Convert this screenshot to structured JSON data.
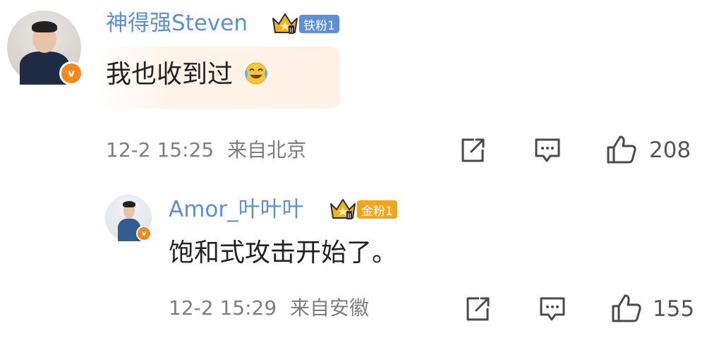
{
  "comments": [
    {
      "username": "神得强Steven",
      "fan_badge": "铁粉1",
      "text": "我也收到过",
      "emoji": "crying-laugh",
      "time": "12-2 15:25",
      "location": "来自北京",
      "likes": "208"
    },
    {
      "username": "Amor_叶叶叶",
      "fan_badge": "金粉1",
      "text": "饱和式攻击开始了。",
      "time": "12-2 15:29",
      "location": "来自安徽",
      "likes": "155"
    }
  ],
  "colors": {
    "username": "#5b8fd6",
    "iron_badge": "#5b8fd6",
    "gold_badge": "#f2a51a",
    "vip": "#f28a1b",
    "meta": "#7d7d7d"
  }
}
